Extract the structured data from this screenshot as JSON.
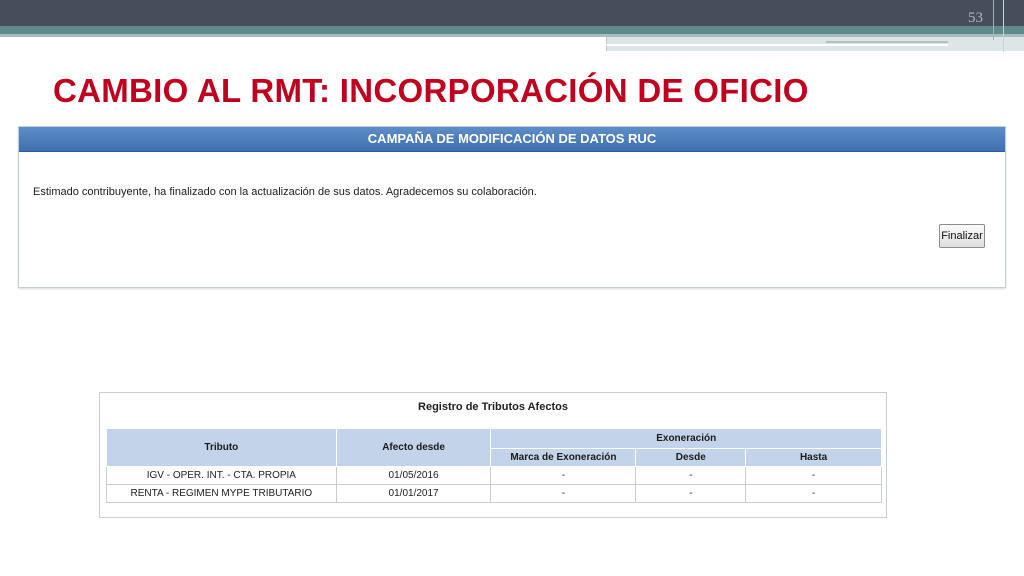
{
  "slide": {
    "number": "53",
    "title": "CAMBIO AL RMT: INCORPORACIÓN DE OFICIO"
  },
  "panel": {
    "header": "CAMPAÑA DE MODIFICACIÓN DE DATOS RUC",
    "message": "Estimado contribuyente, ha finalizado con la actualización de sus datos. Agradecemos su colaboración.",
    "finalize_label": "Finalizar"
  },
  "registro": {
    "caption": "Registro de Tributos Afectos",
    "headers": {
      "tributo": "Tributo",
      "afecto_desde": "Afecto desde",
      "exoneracion": "Exoneración",
      "marca": "Marca de Exoneración",
      "desde": "Desde",
      "hasta": "Hasta"
    },
    "rows": [
      {
        "tributo": "IGV - OPER. INT. - CTA. PROPIA",
        "afecto_desde": "01/05/2016",
        "marca": "-",
        "desde": "-",
        "hasta": "-"
      },
      {
        "tributo": "RENTA - REGIMEN MYPE TRIBUTARIO",
        "afecto_desde": "01/01/2017",
        "marca": "-",
        "desde": "-",
        "hasta": "-"
      }
    ]
  },
  "colors": {
    "title": "#c0001f",
    "panel_header": "#3e6fb0",
    "table_header": "#c3d3ea",
    "top_bar": "#464e5c"
  }
}
